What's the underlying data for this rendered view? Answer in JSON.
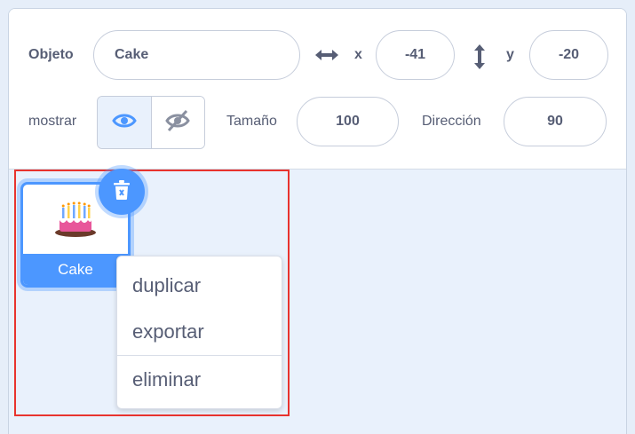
{
  "sprite_info": {
    "sprite_label": "Objeto",
    "sprite_name": "Cake",
    "x_label": "x",
    "x_value": "-41",
    "y_label": "y",
    "y_value": "-20",
    "show_label": "mostrar",
    "size_label": "Tamaño",
    "size_value": "100",
    "direction_label": "Dirección",
    "direction_value": "90",
    "visible": true
  },
  "sprite_list": {
    "items": [
      {
        "name": "Cake",
        "selected": true
      }
    ]
  },
  "context_menu": {
    "items": [
      "duplicar",
      "exportar",
      "eliminar"
    ]
  },
  "colors": {
    "accent": "#4c97ff",
    "text": "#575e75",
    "highlight_border": "#e8332e"
  }
}
